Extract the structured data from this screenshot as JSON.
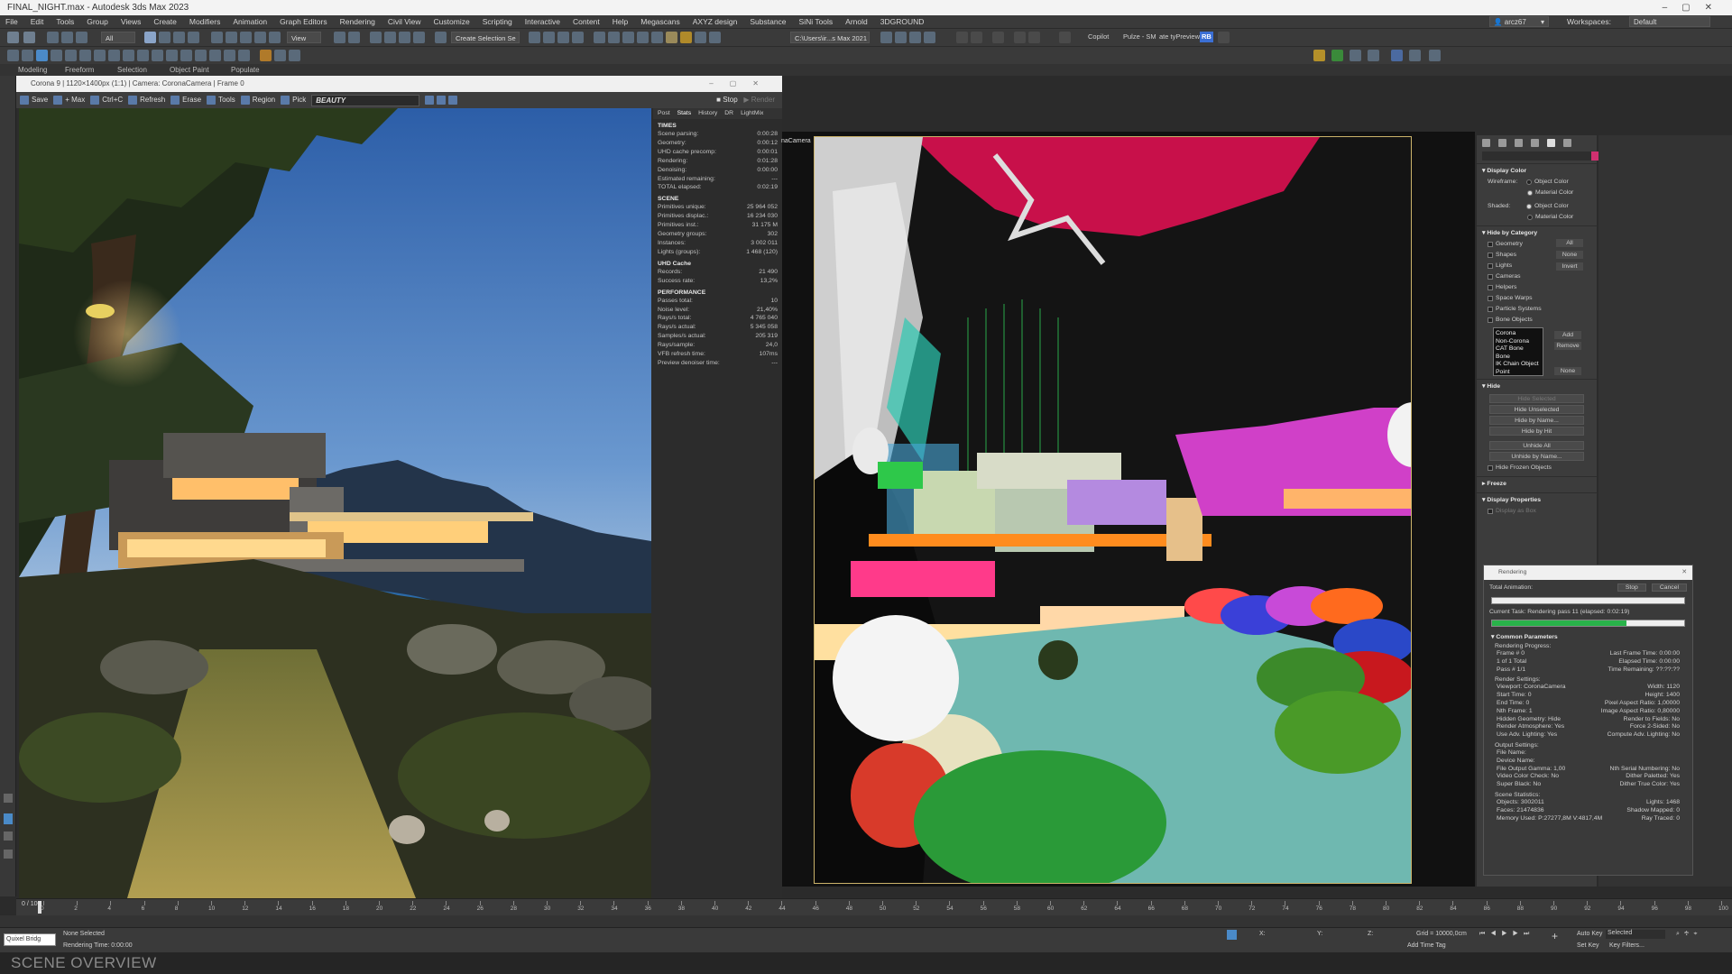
{
  "window": {
    "title": "FINAL_NIGHT.max - Autodesk 3ds Max 2023"
  },
  "menu": [
    "File",
    "Edit",
    "Tools",
    "Group",
    "Views",
    "Create",
    "Modifiers",
    "Animation",
    "Graph Editors",
    "Rendering",
    "Civil View",
    "Customize",
    "Scripting",
    "Interactive",
    "Content",
    "Help",
    "Megascans",
    "AXYZ design",
    "Substance",
    "SiNi Tools",
    "Arnold",
    "3DGROUND"
  ],
  "user": "arcz67",
  "workspace_label": "Workspaces:",
  "workspace_value": "Default",
  "toolbar": {
    "filter": "All",
    "view": "View",
    "create_selection": "Create Selection Se",
    "path": "C:\\Users\\ir...s Max 2021",
    "copilot": "Copilot",
    "pulze": "Pulze - SM",
    "preview": "ate tyPreview",
    "badge": "RB"
  },
  "ribbon_tabs": [
    "Modeling",
    "Freeform",
    "Selection",
    "Object Paint",
    "Populate"
  ],
  "vfb": {
    "title": "Corona 9 | 1120×1400px (1:1) | Camera: CoronaCamera | Frame 0",
    "tools": [
      "Save",
      "+ Max",
      "Ctrl+C",
      "Refresh",
      "Erase",
      "Tools",
      "Region",
      "Pick"
    ],
    "channel": "BEAUTY",
    "stop": "Stop",
    "render": "Render"
  },
  "stats": {
    "tabs": [
      "Post",
      "Stats",
      "History",
      "DR",
      "LightMix"
    ],
    "times_header": "TIMES",
    "times": [
      [
        "Scene parsing:",
        "0:00:28"
      ],
      [
        "Geometry:",
        "0:00:12"
      ],
      [
        "UHD cache precomp:",
        "0:00:01"
      ],
      [
        "Rendering:",
        "0:01:28"
      ],
      [
        "Denoising:",
        "0:00:00"
      ],
      [
        "Estimated remaining:",
        "---"
      ],
      [
        "TOTAL elapsed:",
        "0:02:19"
      ]
    ],
    "scene_header": "SCENE",
    "scene": [
      [
        "Primitives unique:",
        "25 964 052"
      ],
      [
        "Primitives displac.:",
        "16 234 030"
      ],
      [
        "Primitives inst.:",
        "31 175 M"
      ],
      [
        "Geometry groups:",
        "302"
      ],
      [
        "Instances:",
        "3 002 011"
      ],
      [
        "Lights (groups):",
        "1 468 (120)"
      ]
    ],
    "uhd_header": "UHD Cache",
    "uhd": [
      [
        "Records:",
        "21 490"
      ],
      [
        "Success rate:",
        "13,2%"
      ]
    ],
    "perf_header": "PERFORMANCE",
    "perf": [
      [
        "Passes total:",
        "10"
      ],
      [
        "Noise level:",
        "21,40%"
      ],
      [
        "Rays/s total:",
        "4 765 040"
      ],
      [
        "Rays/s actual:",
        "5 345 058"
      ],
      [
        "Samples/s actual:",
        "205 319"
      ],
      [
        "Rays/sample:",
        "24,0"
      ],
      [
        "VFB refresh time:",
        "107ms"
      ],
      [
        "Preview denoiser time:",
        "---"
      ]
    ]
  },
  "viewport": {
    "label": "naCamera"
  },
  "cmd": {
    "display_color": "Display Color",
    "wireframe": "Wireframe:",
    "shaded": "Shaded:",
    "object_color": "Object Color",
    "material_color": "Material Color",
    "hide_by_category": "Hide by Category",
    "categories": [
      "Geometry",
      "Shapes",
      "Lights",
      "Cameras",
      "Helpers",
      "Space Warps",
      "Particle Systems",
      "Bone Objects"
    ],
    "cat_btns": [
      "All",
      "None",
      "Invert"
    ],
    "list": [
      "Corona",
      "Non-Corona",
      "CAT Bone",
      "Bone",
      "IK Chain Object",
      "Point"
    ],
    "list_btns": [
      "Add",
      "Remove",
      "None"
    ],
    "hide": "Hide",
    "hide_btns": [
      "Hide Selected",
      "Hide Unselected",
      "Hide by Name...",
      "Hide by Hit",
      "Unhide All",
      "Unhide by Name...",
      "Hide Frozen Objects"
    ],
    "freeze": "Freeze",
    "display_props": "Display Properties",
    "display_as_box": "Display as Box"
  },
  "progress": {
    "title": "Rendering",
    "total_label": "Total Animation:",
    "stop": "Stop",
    "cancel": "Cancel",
    "current_task": "Current Task:",
    "current_value": "Rendering pass 11 (elapsed: 0:02:19)",
    "current_fraction": 0.7,
    "common": "Common Parameters",
    "rendering_progress": "Rendering Progress:",
    "rows": [
      [
        "Frame # 0",
        "Last Frame Time: 0:00:00"
      ],
      [
        "1 of 1     Total",
        "Elapsed Time: 0:00:00"
      ],
      [
        "Pass # 1/1",
        "Time Remaining: ??:??:??"
      ]
    ],
    "render_settings": "Render Settings:",
    "settings": [
      [
        "Viewport: CoronaCamera",
        "Width: 1120"
      ],
      [
        "Start Time: 0",
        "Height: 1400"
      ],
      [
        "End Time: 0",
        "Pixel Aspect Ratio: 1,00000"
      ],
      [
        "Nth Frame: 1",
        "Image Aspect Ratio: 0,80000"
      ],
      [
        "Hidden Geometry: Hide",
        "Render to Fields: No"
      ],
      [
        "Render Atmosphere: Yes",
        "Force 2-Sided: No"
      ],
      [
        "Use Adv. Lighting: Yes",
        "Compute Adv. Lighting: No"
      ]
    ],
    "output_settings": "Output Settings:",
    "output": [
      [
        "File Name:",
        ""
      ],
      [
        "Device Name:",
        ""
      ],
      [
        "File Output Gamma: 1,00",
        "Nth Serial Numbering: No"
      ],
      [
        "Video Color Check: No",
        "Dither Paletted: Yes"
      ],
      [
        "Super Black: No",
        "Dither True Color: Yes"
      ]
    ],
    "scene_stats": "Scene Statistics:",
    "scene_rows": [
      [
        "Objects: 3002011",
        "Lights: 1468"
      ],
      [
        "Faces: 21474836",
        "Shadow Mapped: 0"
      ],
      [
        "Memory Used: P:27277,8M V:4817,4M",
        "Ray Traced: 0"
      ]
    ]
  },
  "timeline": {
    "frame": "0 / 100",
    "ticks": [
      "0",
      "2",
      "4",
      "6",
      "8",
      "10",
      "12",
      "14",
      "16",
      "18",
      "20",
      "22",
      "24",
      "26",
      "28",
      "30",
      "32",
      "34",
      "36",
      "38",
      "40",
      "42",
      "44",
      "46",
      "48",
      "50",
      "52",
      "54",
      "56",
      "58",
      "60",
      "62",
      "64",
      "66",
      "68",
      "70",
      "72",
      "74",
      "76",
      "78",
      "80",
      "82",
      "84",
      "86",
      "88",
      "90",
      "92",
      "94",
      "96",
      "98",
      "100"
    ]
  },
  "status": {
    "script_label": "Quixel Bridg",
    "none_selected": "None Selected",
    "render_time": "Rendering Time: 0:00:00",
    "x": "X:",
    "y": "Y:",
    "z": "Z:",
    "grid": "Grid = 10000,0cm",
    "add_time_tag": "Add Time Tag",
    "autokey": "Auto Key",
    "selected": "Selected",
    "setkey": "Set Key",
    "keyfilters": "Key Filters..."
  },
  "caption": "SCENE OVERVIEW"
}
